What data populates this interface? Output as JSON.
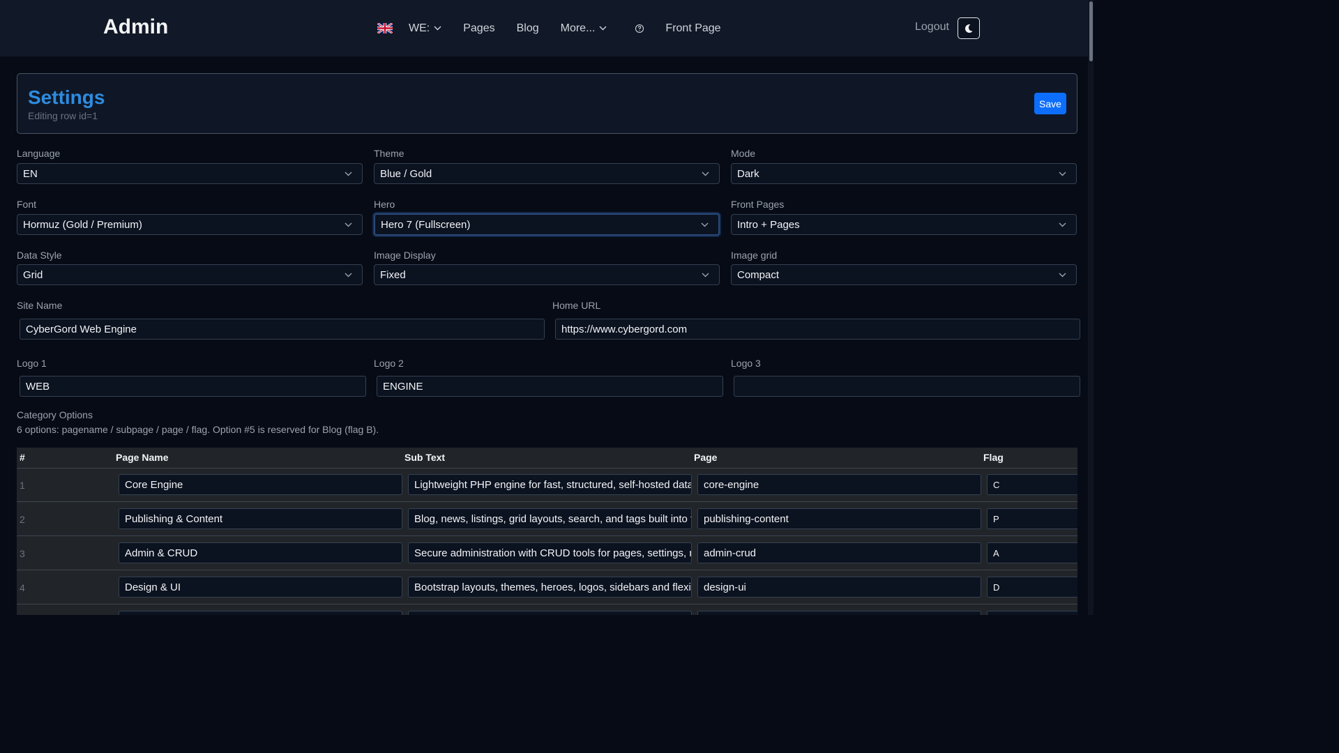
{
  "navbar": {
    "brand": "Admin",
    "links": {
      "we": "WE:",
      "pages": "Pages",
      "blog": "Blog",
      "more": "More...",
      "front_page": "Front Page"
    },
    "logout": "Logout"
  },
  "header": {
    "title": "Settings",
    "subtitle": "Editing row id=1",
    "save_label": "Save"
  },
  "form": {
    "language": {
      "label": "Language",
      "value": "EN"
    },
    "theme": {
      "label": "Theme",
      "value": "Blue / Gold"
    },
    "mode": {
      "label": "Mode",
      "value": "Dark"
    },
    "font": {
      "label": "Font",
      "value": "Hormuz (Gold / Premium)"
    },
    "hero": {
      "label": "Hero",
      "value": "Hero 7 (Fullscreen)"
    },
    "front_pages": {
      "label": "Front Pages",
      "value": "Intro + Pages"
    },
    "data_style": {
      "label": "Data Style",
      "value": "Grid"
    },
    "image_display": {
      "label": "Image Display",
      "value": "Fixed"
    },
    "image_grid": {
      "label": "Image grid",
      "value": "Compact"
    },
    "site_name": {
      "label": "Site Name",
      "value": "CyberGord Web Engine"
    },
    "home_url": {
      "label": "Home URL",
      "value": "https://www.cybergord.com"
    },
    "logo1": {
      "label": "Logo 1",
      "value": "WEB"
    },
    "logo2": {
      "label": "Logo 2",
      "value": "ENGINE"
    },
    "logo3": {
      "label": "Logo 3",
      "value": ""
    }
  },
  "categories": {
    "title": "Category Options",
    "help": "6 options: pagename / subpage / page / flag. Option #5 is reserved for Blog (flag B).",
    "columns": {
      "num": "#",
      "page_name": "Page Name",
      "sub_text": "Sub Text",
      "page": "Page",
      "flag": "Flag"
    },
    "rows": [
      {
        "num": "1",
        "page_name": "Core Engine",
        "sub_text": "Lightweight PHP engine for fast, structured, self-hosted databases",
        "page": "core-engine",
        "flag": "C"
      },
      {
        "num": "2",
        "page_name": "Publishing & Content",
        "sub_text": "Blog, news, listings, grid layouts, search, and tags built into the system",
        "page": "publishing-content",
        "flag": "P"
      },
      {
        "num": "3",
        "page_name": "Admin & CRUD",
        "sub_text": "Secure administration with CRUD tools for pages, settings, media",
        "page": "admin-crud",
        "flag": "A"
      },
      {
        "num": "4",
        "page_name": "Design & UI",
        "sub_text": "Bootstrap layouts, themes, heroes, logos, sidebars and flexible display",
        "page": "design-ui",
        "flag": "D"
      }
    ]
  },
  "colors": {
    "accent": "#2d8ce0",
    "save": "#0d6efd",
    "background": "#060b16",
    "navbar": "#111827"
  }
}
